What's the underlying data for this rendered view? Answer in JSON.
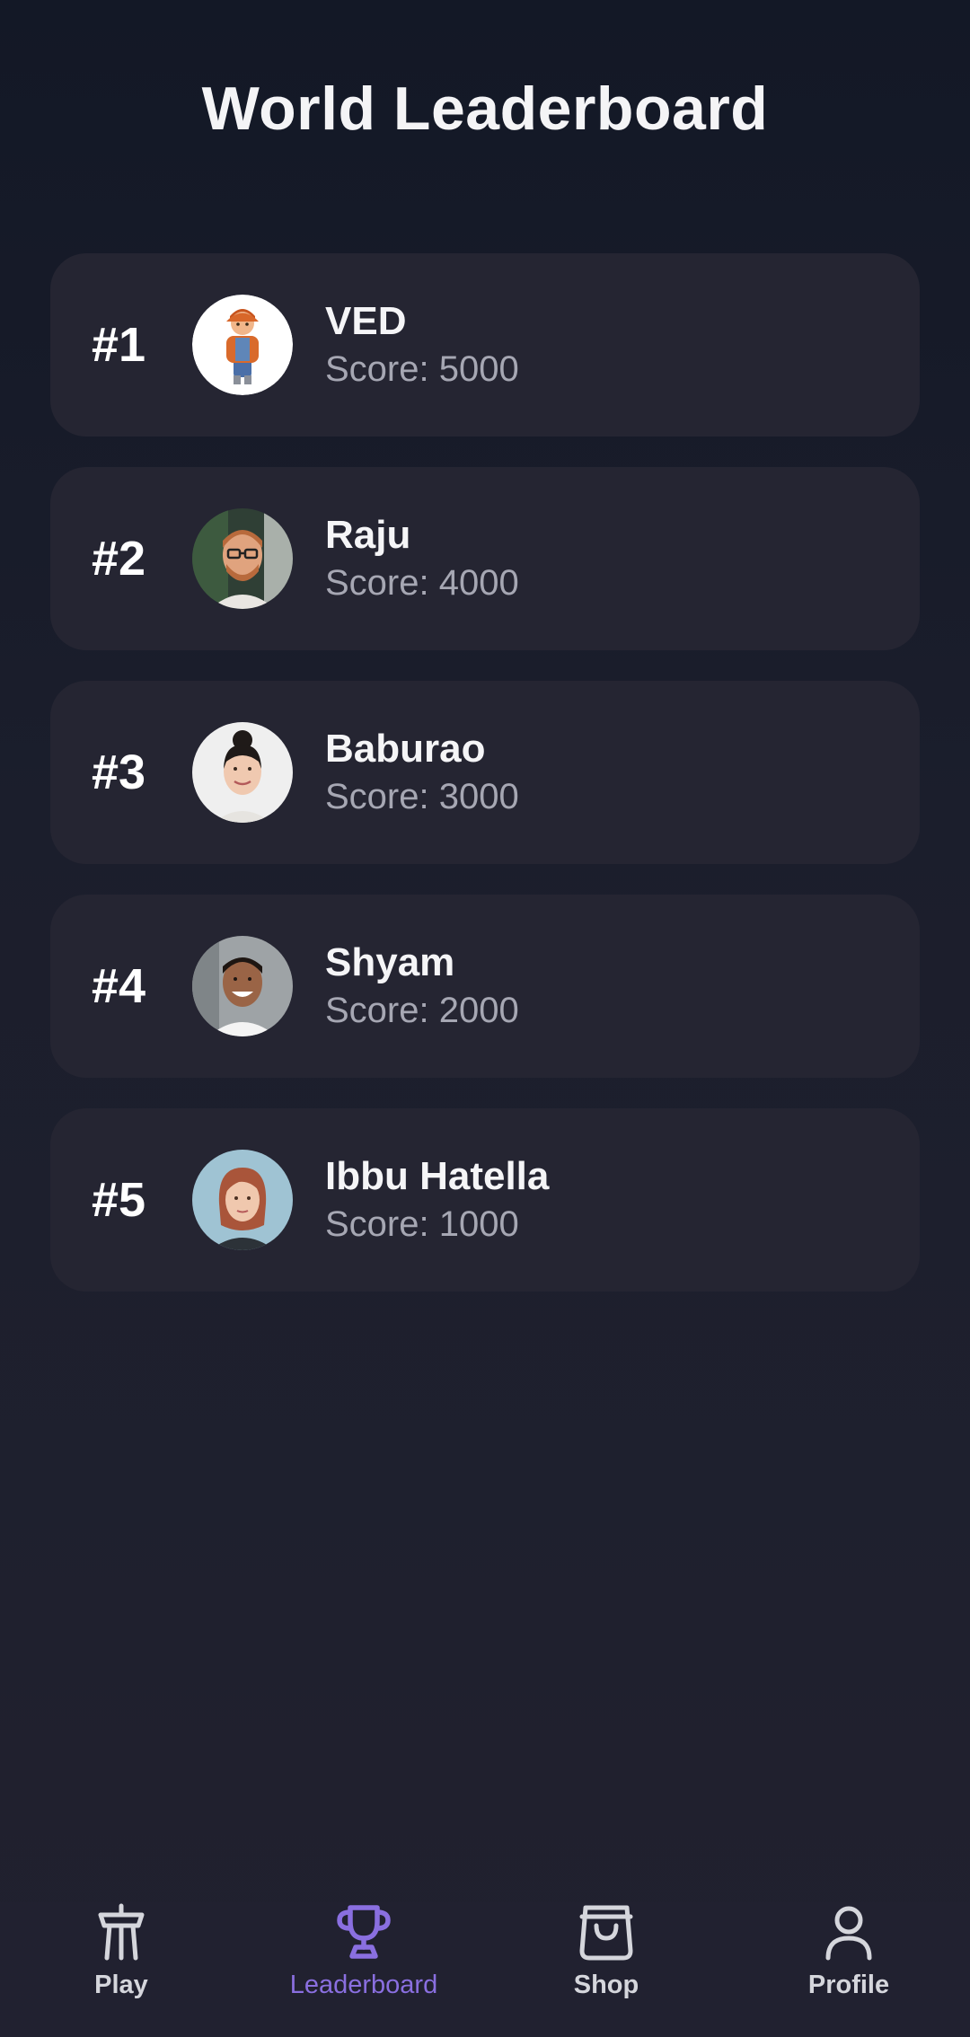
{
  "page": {
    "title": "World Leaderboard"
  },
  "leaderboard": [
    {
      "rank": "#1",
      "name": "VED",
      "score": "Score: 5000",
      "avatar": "cartoon-boy-avatar"
    },
    {
      "rank": "#2",
      "name": "Raju",
      "score": "Score: 4000",
      "avatar": "man-glasses-avatar"
    },
    {
      "rank": "#3",
      "name": "Baburao",
      "score": "Score: 3000",
      "avatar": "woman-bun-avatar"
    },
    {
      "rank": "#4",
      "name": "Shyam",
      "score": "Score: 2000",
      "avatar": "smiling-man-avatar"
    },
    {
      "rank": "#5",
      "name": "Ibbu Hatella",
      "score": "Score: 1000",
      "avatar": "red-hair-woman-avatar"
    }
  ],
  "tabs": [
    {
      "label": "Play",
      "icon": "tower-icon",
      "active": false
    },
    {
      "label": "Leaderboard",
      "icon": "trophy-icon",
      "active": true
    },
    {
      "label": "Shop",
      "icon": "shopping-bag-icon",
      "active": false
    },
    {
      "label": "Profile",
      "icon": "user-icon",
      "active": false
    }
  ],
  "colors": {
    "background": "#1b1e2c",
    "card": "#252532",
    "accent": "#8a6fe0",
    "muted_text": "#a6a7b3"
  }
}
